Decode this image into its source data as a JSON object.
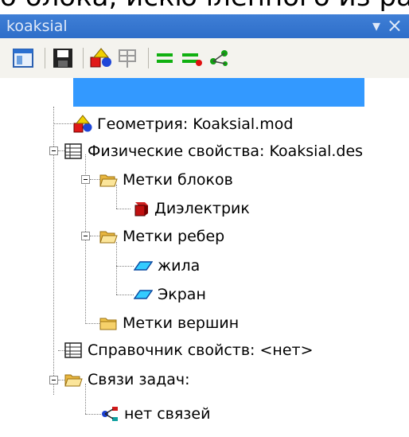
{
  "cutoff_text": "о блока, искючленного из рас",
  "window": {
    "title": "koaksial"
  },
  "toolbar": {
    "icons": [
      "panel-layout-icon",
      "save-icon",
      "geometry-shapes-icon",
      "properties-icon",
      "equals-icon",
      "equals-red-icon",
      "links-icon"
    ]
  },
  "tree": {
    "geometry": "Геометрия: Koaksial.mod",
    "physics": "Физические свойства: Koaksial.des",
    "block_labels": "Метки блоков",
    "dielectric": "Диэлектрик",
    "edge_labels": "Метки ребер",
    "core": "жила",
    "screen": "Экран",
    "vertex_labels": "Метки вершин",
    "reference": "Справочник свойств: <нет>",
    "task_links": "Связи задач:",
    "no_links": "нет связей"
  }
}
